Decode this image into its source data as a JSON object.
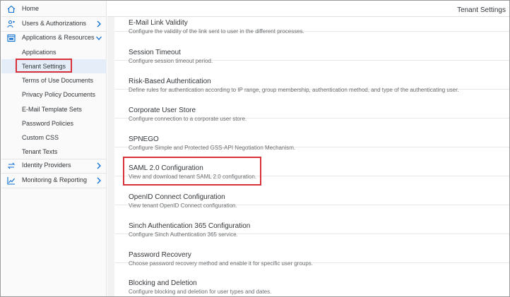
{
  "sidebar": {
    "items": [
      {
        "label": "Home",
        "icon": "home-icon"
      },
      {
        "label": "Users & Authorizations",
        "icon": "user-settings-icon"
      },
      {
        "label": "Applications & Resources",
        "icon": "app-window-icon"
      },
      {
        "label": "Identity Providers",
        "icon": "sync-icon"
      },
      {
        "label": "Monitoring & Reporting",
        "icon": "chart-icon"
      }
    ],
    "sub_items": [
      {
        "label": "Applications"
      },
      {
        "label": "Tenant Settings"
      },
      {
        "label": "Terms of Use Documents"
      },
      {
        "label": "Privacy Policy Documents"
      },
      {
        "label": "E-Mail Template Sets"
      },
      {
        "label": "Password Policies"
      },
      {
        "label": "Custom CSS"
      },
      {
        "label": "Tenant Texts"
      }
    ]
  },
  "header": {
    "title": "Tenant Settings"
  },
  "settings": [
    {
      "title": "E-Mail Link Validity",
      "desc": "Configure the validity of the link sent to user in the different processes."
    },
    {
      "title": "Session Timeout",
      "desc": "Configure session timeout period."
    },
    {
      "title": "Risk-Based Authentication",
      "desc": "Define rules for authentication according to IP range, group membership, authentication method, and type of the authenticating user."
    },
    {
      "title": "Corporate User Store",
      "desc": "Configure connection to a corporate user store."
    },
    {
      "title": "SPNEGO",
      "desc": "Configure Simple and Protected GSS-API Negotiation Mechanism."
    },
    {
      "title": "SAML 2.0 Configuration",
      "desc": "View and download tenant SAML 2.0 configuration."
    },
    {
      "title": "OpenID Connect Configuration",
      "desc": "View tenant OpenID Connect configuration."
    },
    {
      "title": "Sinch Authentication 365 Configuration",
      "desc": "Configure Sinch Authentication 365 service."
    },
    {
      "title": "Password Recovery",
      "desc": "Choose password recovery method and enable it for specific user groups."
    },
    {
      "title": "Blocking and Deletion",
      "desc": "Configure blocking and deletion for user types and dates."
    }
  ],
  "colors": {
    "accent": "#0a6ed1",
    "highlight": "#d9303a",
    "selected_bg": "#e5eef8"
  }
}
